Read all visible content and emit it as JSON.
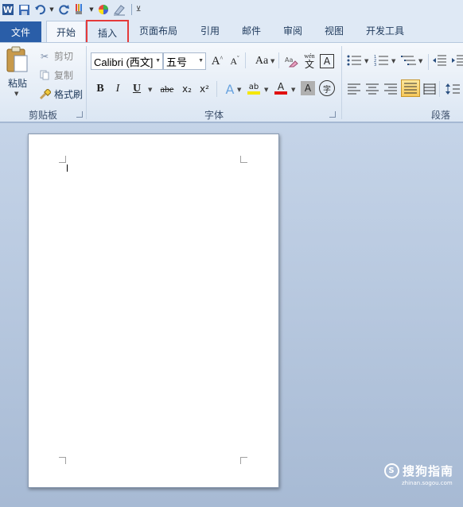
{
  "tabs": {
    "file": "文件",
    "home": "开始",
    "insert": "插入",
    "page_layout": "页面布局",
    "references": "引用",
    "mailings": "邮件",
    "review": "审阅",
    "view": "视图",
    "developer": "开发工具"
  },
  "clipboard": {
    "paste": "粘贴",
    "cut": "剪切",
    "copy": "复制",
    "format_painter": "格式刷",
    "group_label": "剪贴板"
  },
  "font": {
    "name": "Calibri (西文]",
    "size": "五号",
    "group_label": "字体",
    "grow": "A",
    "shrink": "A",
    "change_case": "Aa",
    "bold": "B",
    "italic": "I",
    "underline": "U",
    "strike": "abe",
    "subscript": "x₂",
    "superscript": "x²",
    "phonetic": "wén",
    "phonetic_char": "文",
    "border_char": "A",
    "font_color": "A",
    "shade_char": "A",
    "enclose_char": "字",
    "effects": "A",
    "highlight": "ab"
  },
  "paragraph": {
    "group_label": "段落"
  },
  "watermark": {
    "brand": "搜狗指南",
    "url": "zhinan.sogou.com",
    "logo": "S"
  },
  "colors": {
    "file_tab": "#2a5ea8",
    "highlight_box": "#e53a3a",
    "font_color_bar": "#e01010",
    "highlight_bar": "#f5e700",
    "active_align": "#f6c85a"
  }
}
